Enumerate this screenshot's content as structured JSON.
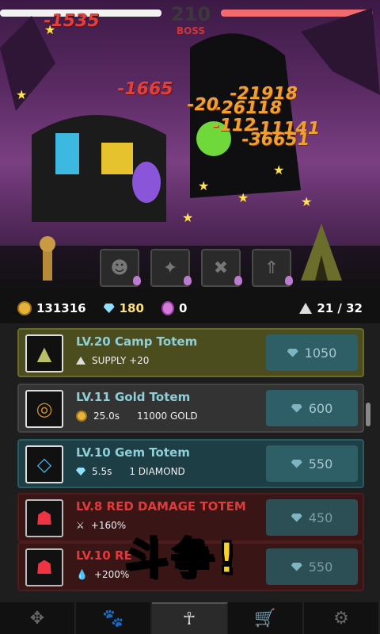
{
  "hud": {
    "boss_count": "210",
    "boss_label": "BOSS"
  },
  "damage_numbers": [
    "-1535",
    "-1665",
    "-21918",
    "-26118",
    "-20",
    "-112",
    "-11141",
    "-36651"
  ],
  "resources": {
    "gold": "131316",
    "diamonds": "180",
    "potions": "0",
    "camp": "21 / 32"
  },
  "totems": [
    {
      "title": "LV.20 Camp Totem",
      "stat1": "SUPPLY +20",
      "stat2": "",
      "price": "1050",
      "icon": "tent-icon"
    },
    {
      "title": "LV.11 Gold Totem",
      "stat1": "25.0s",
      "stat2": "11000 GOLD",
      "price": "600",
      "icon": "gold-ring-icon"
    },
    {
      "title": "LV.10 Gem Totem",
      "stat1": "5.5s",
      "stat2": "1 DIAMOND",
      "price": "550",
      "icon": "diamond-icon"
    },
    {
      "title": "LV.8  RED DAMAGE TOTEM",
      "stat1": "+160%",
      "stat2": "",
      "price": "450",
      "icon": "red-totem-icon"
    },
    {
      "title": "LV.10 RE",
      "stat1": "+200%",
      "stat2": "",
      "price": "550",
      "icon": "red-totem-icon"
    }
  ],
  "fight_label": "斗争!",
  "nav": [
    "units-tab",
    "pets-tab",
    "totems-tab",
    "shop-tab",
    "settings-tab"
  ]
}
